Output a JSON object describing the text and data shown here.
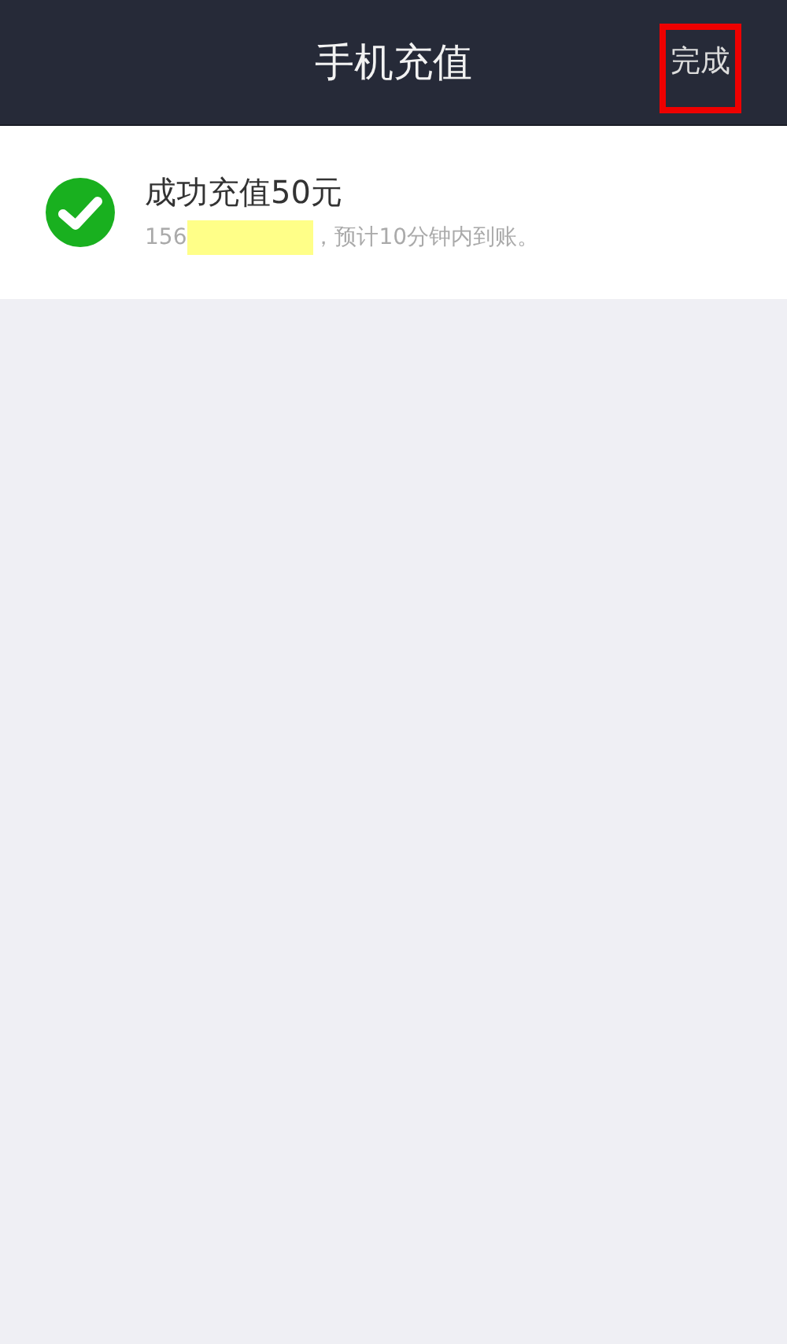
{
  "header": {
    "title": "手机充值",
    "done_button": {
      "label": "完成",
      "highlighted": true
    }
  },
  "result": {
    "kind": "success",
    "title": "成功充值50元",
    "phone_prefix": "156",
    "phone_redacted": true,
    "note": "，预计10分钟内到账。"
  }
}
